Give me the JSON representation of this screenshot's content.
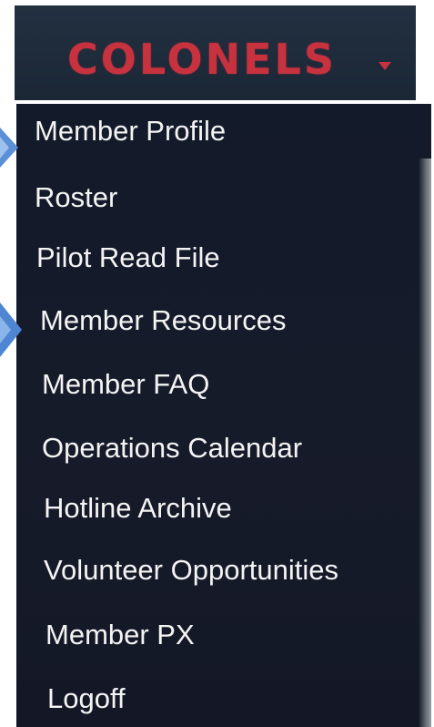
{
  "header": {
    "title": "COLONELS",
    "caret_icon": "caret-down-icon",
    "title_color": "#c8323f",
    "background": "#1f2c3a"
  },
  "dropdown": {
    "background": "#141a29",
    "text_color": "#f4f4f4",
    "items": [
      {
        "label": "Member Profile"
      },
      {
        "label": "Roster"
      },
      {
        "label": "Pilot Read File"
      },
      {
        "label": "Member Resources"
      },
      {
        "label": "Member FAQ"
      },
      {
        "label": "Operations Calendar"
      },
      {
        "label": "Hotline Archive"
      },
      {
        "label": "Volunteer Opportunities"
      },
      {
        "label": "Member PX"
      },
      {
        "label": "Logoff"
      }
    ]
  },
  "annotations": {
    "pointer_color": "#5b8fd6",
    "pointers": [
      "arrow-pointer-icon",
      "arrow-pointer-icon"
    ]
  }
}
